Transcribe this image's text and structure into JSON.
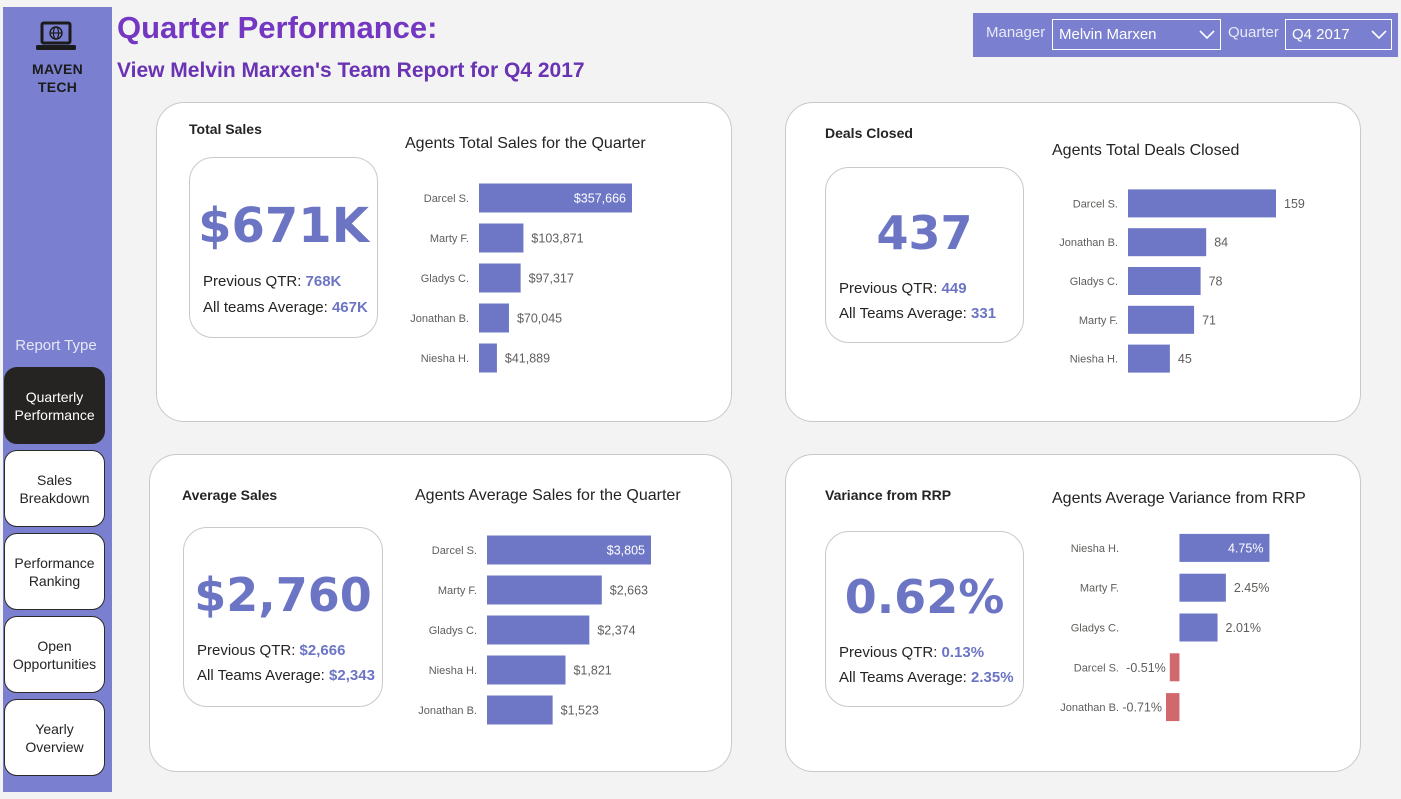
{
  "brand": {
    "line1": "MAVEN",
    "line2": "TECH",
    "icon": "laptop-globe-icon"
  },
  "sidebar": {
    "section_label": "Report Type",
    "items": [
      {
        "label": "Quarterly Performance",
        "active": true
      },
      {
        "label": "Sales Breakdown",
        "active": false
      },
      {
        "label": "Performance Ranking",
        "active": false
      },
      {
        "label": "Open Opportunities",
        "active": false
      },
      {
        "label": "Yearly Overview",
        "active": false
      }
    ]
  },
  "header": {
    "title": "Quarter Performance:",
    "subtitle": "View Melvin Marxen's Team Report for Q4 2017"
  },
  "filters": {
    "manager_label": "Manager",
    "manager_value": "Melvin Marxen",
    "quarter_label": "Quarter",
    "quarter_value": "Q4 2017"
  },
  "colors": {
    "accent": "#6c74c4",
    "bar": "#6e77c5",
    "negative": "#d0686e",
    "sidebar": "#7a80cf",
    "title": "#7337c1"
  },
  "cards": {
    "total_sales": {
      "title": "Total Sales",
      "value": "$671K",
      "prev_label": "Previous QTR:",
      "prev_value": "768K",
      "avg_label": "All teams Average:",
      "avg_value": "467K"
    },
    "deals_closed": {
      "title": "Deals Closed",
      "value": "437",
      "prev_label": "Previous QTR:",
      "prev_value": "449",
      "avg_label": "All Teams Average:",
      "avg_value": "331"
    },
    "average_sales": {
      "title": "Average Sales",
      "value": "$2,760",
      "prev_label": "Previous QTR:",
      "prev_value": "$2,666",
      "avg_label": "All Teams Average:",
      "avg_value": "$2,343"
    },
    "variance_rrp": {
      "title": "Variance from RRP",
      "value": "0.62%",
      "prev_label": "Previous QTR:",
      "prev_value": "0.13%",
      "avg_label": "All Teams Average:",
      "avg_value": "2.35%"
    }
  },
  "chart_data": [
    {
      "id": "total_sales",
      "type": "bar",
      "orientation": "horizontal",
      "title": "Agents Total Sales for the Quarter",
      "categories": [
        "Darcel S.",
        "Marty F.",
        "Gladys C.",
        "Jonathan B.",
        "Niesha H."
      ],
      "values": [
        357666,
        103871,
        97317,
        70045,
        41889
      ],
      "labels": [
        "$357,666",
        "$103,871",
        "$97,317",
        "$70,045",
        "$41,889"
      ],
      "inside_first_label": true
    },
    {
      "id": "deals_closed",
      "type": "bar",
      "orientation": "horizontal",
      "title": "Agents Total Deals Closed",
      "categories": [
        "Darcel S.",
        "Jonathan B.",
        "Gladys C.",
        "Marty F.",
        "Niesha H."
      ],
      "values": [
        159,
        84,
        78,
        71,
        45
      ],
      "labels": [
        "159",
        "84",
        "78",
        "71",
        "45"
      ],
      "inside_first_label": false
    },
    {
      "id": "average_sales",
      "type": "bar",
      "orientation": "horizontal",
      "title": "Agents Average Sales for the Quarter",
      "categories": [
        "Darcel S.",
        "Marty F.",
        "Gladys C.",
        "Niesha H.",
        "Jonathan B."
      ],
      "values": [
        3805,
        2663,
        2374,
        1821,
        1523
      ],
      "labels": [
        "$3,805",
        "$2,663",
        "$2,374",
        "$1,821",
        "$1,523"
      ],
      "inside_first_label": true
    },
    {
      "id": "variance_rrp",
      "type": "bar",
      "orientation": "horizontal",
      "title": "Agents Average Variance from RRP",
      "categories": [
        "Niesha H.",
        "Marty F.",
        "Gladys C.",
        "Darcel S.",
        "Jonathan B."
      ],
      "values": [
        4.75,
        2.45,
        2.01,
        -0.51,
        -0.71
      ],
      "labels": [
        "4.75%",
        "2.45%",
        "2.01%",
        "-0.51%",
        "-0.71%"
      ],
      "inside_first_label": true
    }
  ]
}
